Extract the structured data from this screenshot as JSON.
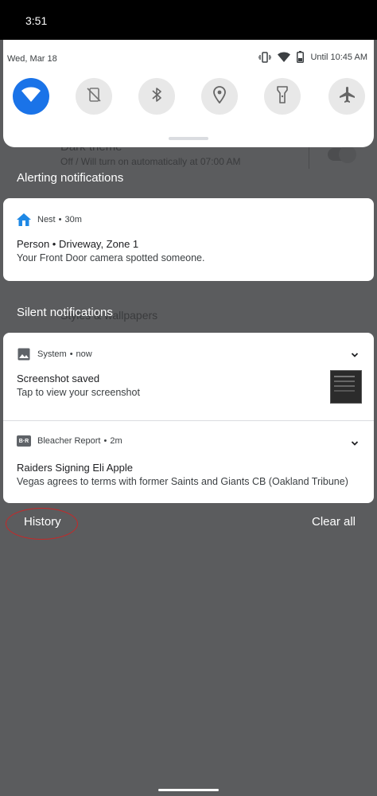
{
  "status_bar": {
    "time": "3:51"
  },
  "background_settings": {
    "dark_theme_title": "Dark theme",
    "dark_theme_subtitle": "Off / Will turn on automatically at 07:00 AM",
    "styles_label": "Styles & wallpapers"
  },
  "quick_settings": {
    "date": "Wed, Mar 18",
    "alarm": "Until 10:45 AM",
    "tiles": [
      {
        "name": "wifi",
        "active": true
      },
      {
        "name": "auto-rotate",
        "active": false
      },
      {
        "name": "bluetooth",
        "active": false
      },
      {
        "name": "location",
        "active": false
      },
      {
        "name": "flashlight",
        "active": false
      },
      {
        "name": "airplane-mode",
        "active": false
      }
    ],
    "accent_color": "#1a73e8"
  },
  "alerting": {
    "label": "Alerting notifications",
    "notifications": [
      {
        "app": "Nest",
        "time": "30m",
        "title": "Person • Driveway, Zone 1",
        "text": "Your Front Door camera spotted someone."
      }
    ]
  },
  "silent": {
    "label": "Silent notifications",
    "notifications": [
      {
        "app": "System",
        "time": "now",
        "title": "Screenshot saved",
        "text": "Tap to view your screenshot"
      },
      {
        "app": "Bleacher Report",
        "app_icon_text": "B·R",
        "time": "2m",
        "title": "Raiders Signing Eli Apple",
        "text": "Vegas agrees to terms with former Saints and Giants CB (Oakland Tribune)"
      }
    ]
  },
  "footer": {
    "history_label": "History",
    "clear_label": "Clear all"
  }
}
